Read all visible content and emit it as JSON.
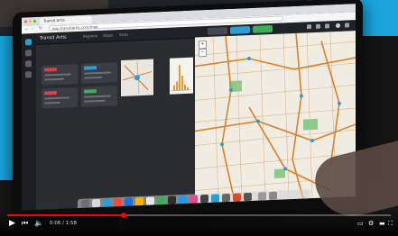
{
  "browser": {
    "tab_label": "Transit Artis",
    "url": "app.transitartis.com/map"
  },
  "app": {
    "brand": "Transit Artis",
    "nav": [
      "Regions",
      "Stops",
      "Stats"
    ],
    "actions": [
      "",
      "",
      ""
    ]
  },
  "panel": {
    "header": ""
  },
  "player": {
    "time": "0:06 / 1:58"
  },
  "colors": {
    "accent_blue": "#1aa5dc",
    "progress_red": "#ff0000",
    "road_orange": "#d9822b",
    "park_green": "#8fc98a",
    "button_red": "#d8404a",
    "button_teal": "#2a9fd6",
    "button_green": "#3fae5b"
  },
  "icons": {
    "play": "play-icon",
    "prev": "previous-icon",
    "volume": "volume-icon",
    "settings": "gear-icon",
    "fullscreen": "fullscreen-icon"
  }
}
